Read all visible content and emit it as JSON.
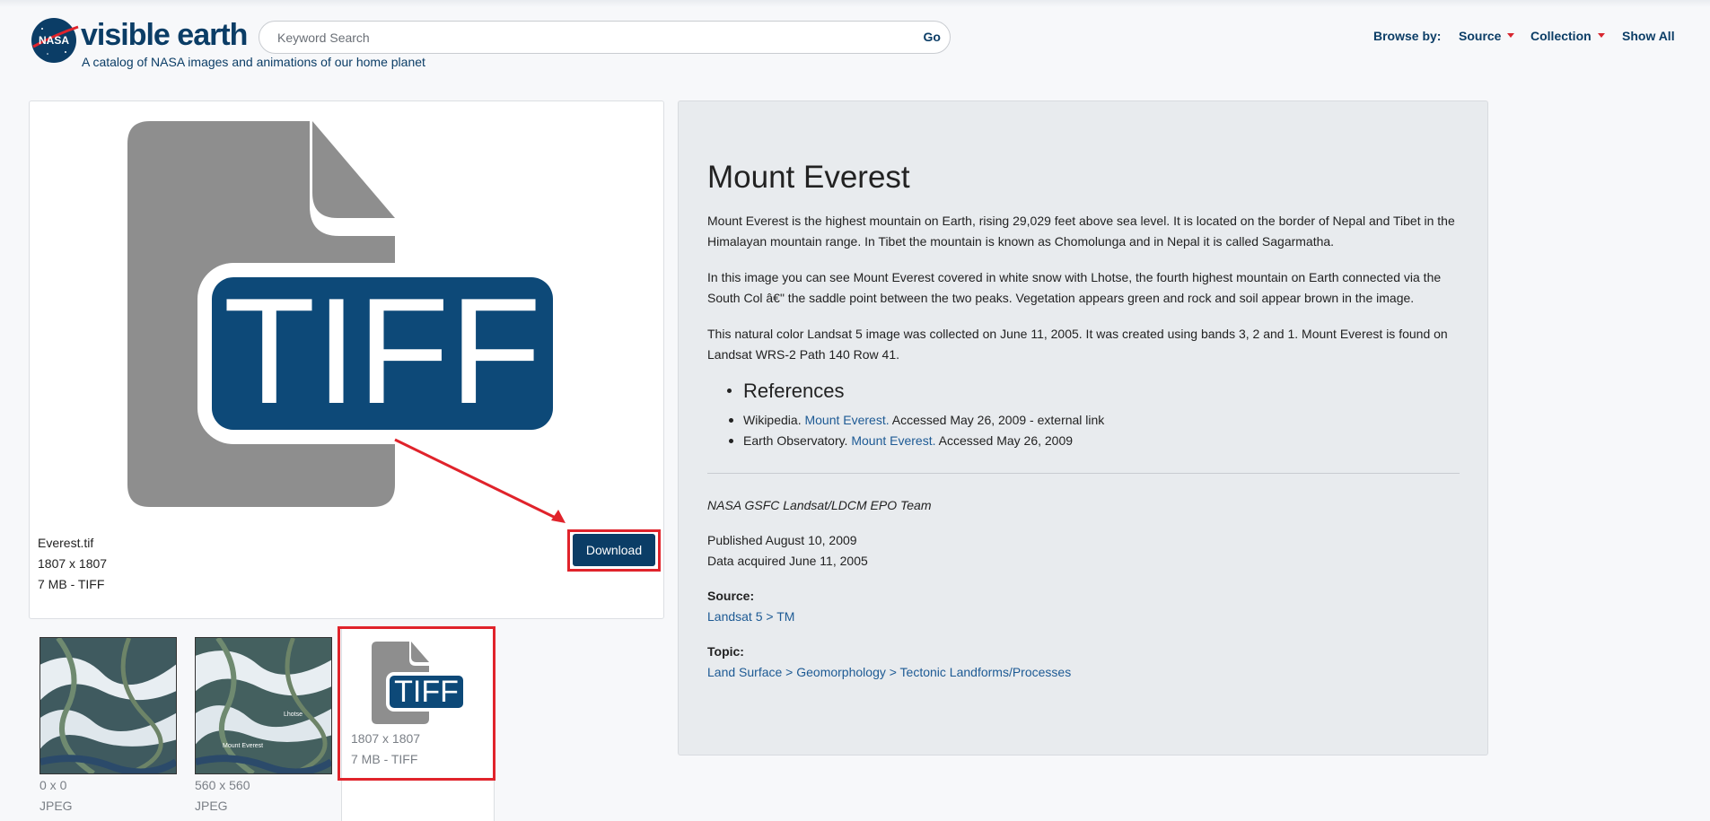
{
  "header": {
    "brand_badge": "NASA",
    "brand_name": "visible earth",
    "tagline": "A catalog of NASA images and animations of our home planet",
    "search_placeholder": "Keyword Search",
    "search_go": "Go",
    "browse_by": "Browse by:",
    "source": "Source",
    "collection": "Collection",
    "show_all": "Show All"
  },
  "preview": {
    "icon_text": "TIFF",
    "file_name": "Everest.tif",
    "dimensions": "1807 x 1807",
    "size_type": "7 MB - TIFF",
    "download_label": "Download"
  },
  "thumbnails": [
    {
      "dimensions": "0 x 0",
      "type": "JPEG"
    },
    {
      "dimensions": "560 x 560",
      "type": "JPEG",
      "caption": "Mount Everest",
      "caption2": "Lhotse"
    },
    {
      "icon_text": "TIFF",
      "dimensions": "1807 x 1807",
      "type": "7 MB - TIFF"
    }
  ],
  "article": {
    "title": "Mount Everest",
    "paragraphs": [
      "Mount Everest is the highest mountain on Earth, rising 29,029 feet above sea level. It is located on the border of Nepal and Tibet in the Himalayan mountain range. In Tibet the mountain is known as Chomolunga and in Nepal it is called Sagarmatha.",
      "In this image you can see Mount Everest covered in white snow with Lhotse, the fourth highest mountain on Earth connected via the South Col â€\" the saddle point between the two peaks. Vegetation appears green and rock and soil appear brown in the image.",
      "This natural color Landsat 5 image was collected on June 11, 2005. It was created using bands 3, 2 and 1. Mount Everest is found on Landsat WRS-2 Path 140 Row 41."
    ],
    "references_heading": "References",
    "references": [
      {
        "prefix": "Wikipedia. ",
        "link": "Mount Everest.",
        "suffix": " Accessed May 26, 2009 - external link"
      },
      {
        "prefix": "Earth Observatory. ",
        "link": "Mount Everest.",
        "suffix": " Accessed May 26, 2009"
      }
    ],
    "credit": "NASA GSFC Landsat/LDCM EPO Team",
    "published": "Published August 10, 2009",
    "acquired": "Data acquired June 11, 2005",
    "source_label": "Source:",
    "source_value": "Landsat 5 > TM",
    "topic_label": "Topic:",
    "topic_value": "Land Surface > Geomorphology > Tectonic Landforms/Processes"
  },
  "colors": {
    "brand": "#0b3d66",
    "highlight": "#e0232b",
    "icon_gray": "#8e8e8e"
  }
}
